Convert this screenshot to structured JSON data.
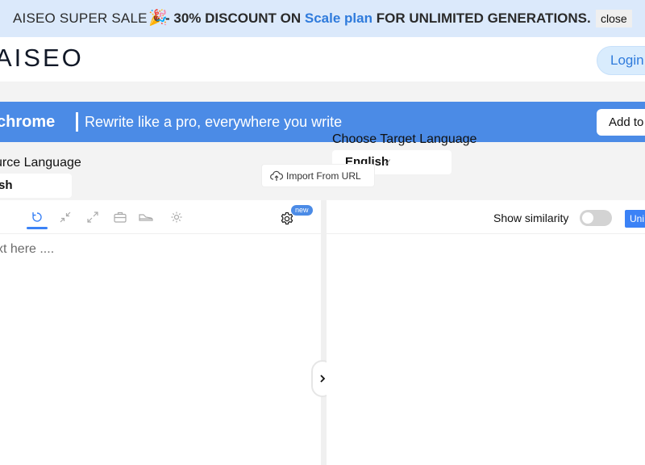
{
  "promo": {
    "lead": "AISEO SUPER SALE",
    "emoji": "🎉",
    "dash": "- ",
    "discount": "30% DISCOUNT ON ",
    "plan": "Scale plan",
    "tail": " FOR UNLIMITED GENERATIONS.",
    "close_label": "close",
    "highlight_color": "#2f7bdc"
  },
  "header": {
    "logo": "AISEO",
    "login_label": "Login"
  },
  "chrome_bar": {
    "brand": "chrome",
    "tagline": "Rewrite like a pro, everywhere you write",
    "add_label": "Add to",
    "background": "#4b8be6"
  },
  "languages": {
    "source_label": "urce Language",
    "source_value": "sh",
    "target_label": "Choose Target Language",
    "target_value": "English",
    "import_label": "Import From URL"
  },
  "editor": {
    "toolbar_icons": [
      "rewrite-icon",
      "shorten-icon",
      "expand-icon",
      "briefcase-icon",
      "shoe-icon",
      "sun-icon",
      "gear-icon"
    ],
    "new_badge": "new",
    "placeholder": "xt here ....",
    "similarity_label": "Show similarity",
    "similarity_on": false,
    "uni_label": "Uni"
  }
}
